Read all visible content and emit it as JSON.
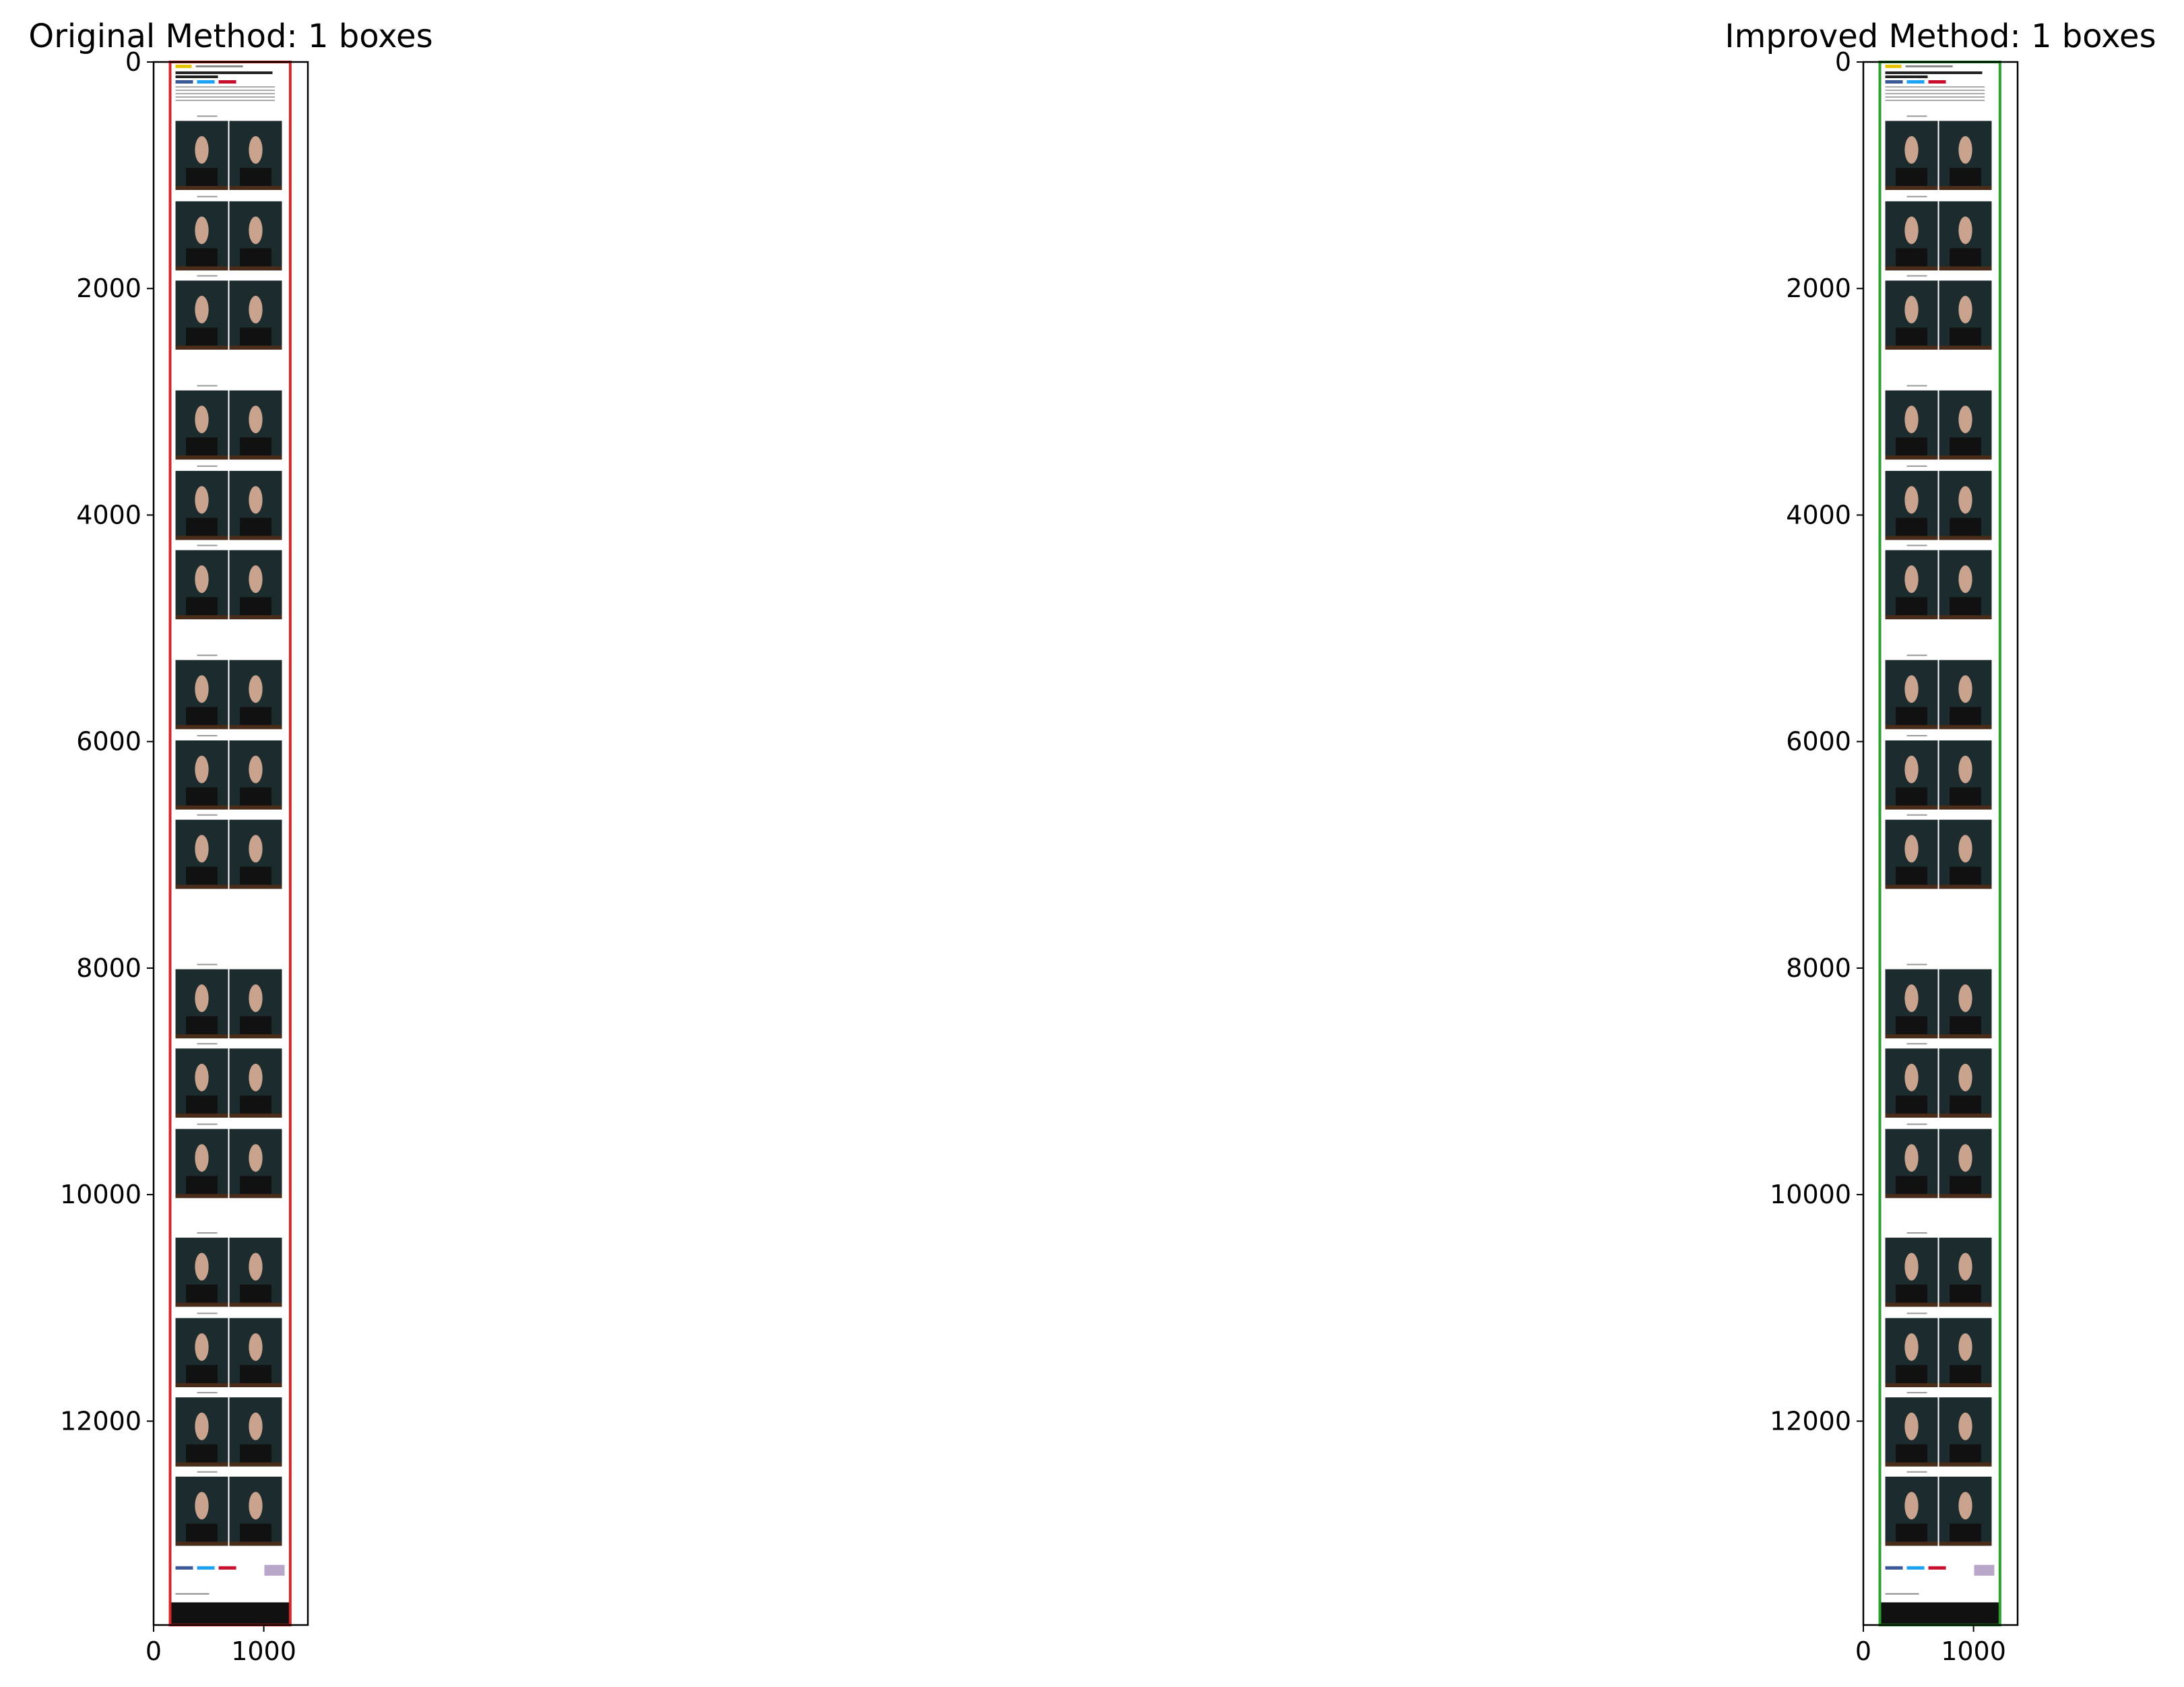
{
  "chart_data": [
    {
      "type": "image",
      "title": "Original Method: 1 boxes",
      "xlim": [
        0,
        1400
      ],
      "ylim": [
        13800,
        0
      ],
      "x_ticks": [
        0,
        1000
      ],
      "y_ticks": [
        0,
        2000,
        4000,
        6000,
        8000,
        10000,
        12000
      ],
      "grid": false,
      "image_extent": {
        "x": [
          150,
          1250
        ],
        "y": [
          0,
          13800
        ]
      },
      "boxes": [
        {
          "color": "#d62728",
          "x": [
            150,
            1240
          ],
          "y": [
            0,
            13800
          ]
        }
      ],
      "photo_rows_y": [
        [
          520,
          1130
        ],
        [
          1230,
          1840
        ],
        [
          1930,
          2540
        ],
        [
          2900,
          3510
        ],
        [
          3610,
          4220
        ],
        [
          4310,
          4920
        ],
        [
          5280,
          5890
        ],
        [
          5990,
          6600
        ],
        [
          6690,
          7300
        ],
        [
          8010,
          8620
        ],
        [
          8710,
          9320
        ],
        [
          9420,
          10030
        ],
        [
          10380,
          10990
        ],
        [
          11090,
          11700
        ],
        [
          11790,
          12400
        ],
        [
          12490,
          13100
        ]
      ]
    },
    {
      "type": "image",
      "title": "Improved Method: 1 boxes",
      "xlim": [
        0,
        1400
      ],
      "ylim": [
        13800,
        0
      ],
      "x_ticks": [
        0,
        1000
      ],
      "y_ticks": [
        0,
        2000,
        4000,
        6000,
        8000,
        10000,
        12000
      ],
      "grid": false,
      "image_extent": {
        "x": [
          150,
          1250
        ],
        "y": [
          0,
          13800
        ]
      },
      "boxes": [
        {
          "color": "#2ca02c",
          "x": [
            150,
            1240
          ],
          "y": [
            0,
            13800
          ]
        }
      ],
      "photo_rows_y": [
        [
          520,
          1130
        ],
        [
          1230,
          1840
        ],
        [
          1930,
          2540
        ],
        [
          2900,
          3510
        ],
        [
          3610,
          4220
        ],
        [
          4310,
          4920
        ],
        [
          5280,
          5890
        ],
        [
          5990,
          6600
        ],
        [
          6690,
          7300
        ],
        [
          8010,
          8620
        ],
        [
          8710,
          9320
        ],
        [
          9420,
          10030
        ],
        [
          10380,
          10990
        ],
        [
          11090,
          11700
        ],
        [
          11790,
          12400
        ],
        [
          12490,
          13100
        ]
      ]
    }
  ]
}
